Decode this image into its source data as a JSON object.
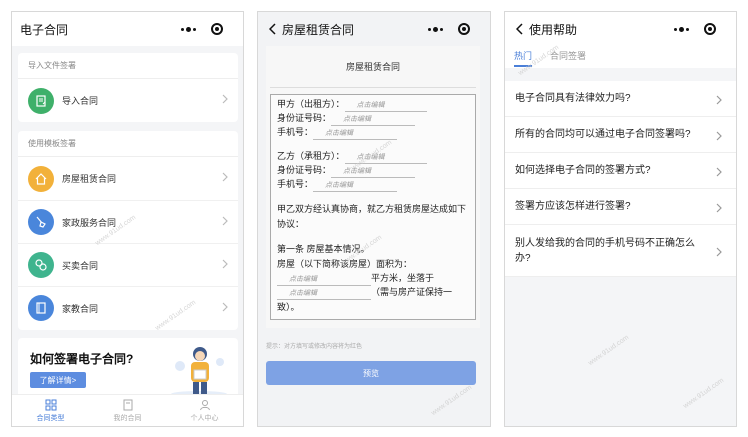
{
  "panel1": {
    "title": "电子合同",
    "import_section": "导入文件签署",
    "import_item": "导入合同",
    "template_section": "使用模板签署",
    "templates": [
      {
        "label": "房屋租赁合同",
        "icon": "house-icon",
        "color": "#f2b13a"
      },
      {
        "label": "家政服务合同",
        "icon": "broom-icon",
        "color": "#4a86db"
      },
      {
        "label": "买卖合同",
        "icon": "exchange-icon",
        "color": "#3fb48e"
      },
      {
        "label": "家教合同",
        "icon": "book-icon",
        "color": "#4a86db"
      }
    ],
    "import_color": "#3fb06a",
    "banner_title": "如何签署电子合同?",
    "banner_button": "了解详情>",
    "tabs": [
      "合同类型",
      "我的合同",
      "个人中心"
    ]
  },
  "panel2": {
    "title": "房屋租赁合同",
    "doc_title": "房屋租赁合同",
    "placeholder": "点击编辑",
    "party_a": "甲方（出租方）：",
    "id_no": "身份证号码：",
    "phone": "手机号：",
    "party_b": "乙方（承租方）：",
    "intro_1": "甲乙双方经认真协商，就乙方租赁房屋达成如下",
    "intro_2": "协议：",
    "clause_title": "第一条 房屋基本情况。",
    "house_label": "房屋（以下简称该房屋）面积为：",
    "area_suffix": "平方米，坐落于",
    "cert_note": "（需与房产证保持一",
    "cert_end": "致）。",
    "hint": "提示：对方填写或修改内容将为红色",
    "preview": "预览"
  },
  "panel3": {
    "title": "使用帮助",
    "tabs": [
      "热门",
      "合同签署"
    ],
    "questions": [
      "电子合同具有法律效力吗?",
      "所有的合同均可以通过电子合同签署吗?",
      "如何选择电子合同的签署方式?",
      "签署方应该怎样进行签署?",
      "别人发给我的合同的手机号码不正确怎么办?"
    ]
  },
  "watermark": "www.91ud.com"
}
